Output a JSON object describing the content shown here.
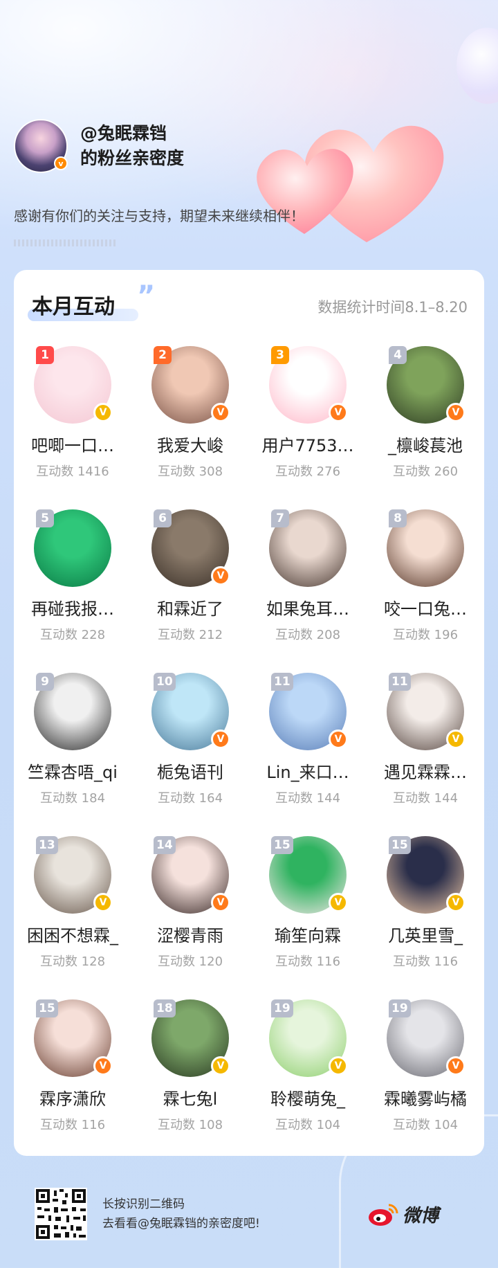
{
  "header": {
    "owner_handle": "@兔眠霖铛",
    "subtitle": "的粉丝亲密度",
    "thanks": "感谢有你们的关注与支持，期望未来继续相伴！"
  },
  "card": {
    "title": "本月互动",
    "quote": "”",
    "stat_time": "数据统计时间8.1–8.20"
  },
  "colors": {
    "rank_top1": "#ff4a4a",
    "rank_top2": "#ff6a2a",
    "rank_top3": "#ff9a00",
    "rank_other": "#b7bccb",
    "badge_orange": "#ff7a1a",
    "badge_gold": "#f5b800"
  },
  "fans": [
    {
      "rank": "1",
      "name": "吧唧一口…",
      "count": "互动数 1416",
      "badge": "gold",
      "avatar": [
        "#fde6ec",
        "#f4c7d3"
      ]
    },
    {
      "rank": "2",
      "name": "我爱大峻",
      "count": "互动数 308",
      "badge": "orange",
      "avatar": [
        "#f0c8b4",
        "#7a5347"
      ]
    },
    {
      "rank": "3",
      "name": "用户7753…",
      "count": "互动数 276",
      "badge": "orange",
      "avatar": [
        "#ffffff",
        "#ffb7c8"
      ]
    },
    {
      "rank": "4",
      "name": "_檩峻萇池",
      "count": "互动数 260",
      "badge": "orange",
      "avatar": [
        "#7fa35b",
        "#2f3d24"
      ]
    },
    {
      "rank": "5",
      "name": "再碰我报…",
      "count": "互动数 228",
      "badge": "",
      "avatar": [
        "#2fc77a",
        "#0a7a45"
      ]
    },
    {
      "rank": "6",
      "name": "和霖近了",
      "count": "互动数 212",
      "badge": "orange",
      "avatar": [
        "#8a7a6a",
        "#3a3028"
      ]
    },
    {
      "rank": "7",
      "name": "如果兔耳…",
      "count": "互动数 208",
      "badge": "",
      "avatar": [
        "#e9d8cf",
        "#4a3a33"
      ]
    },
    {
      "rank": "8",
      "name": "咬一口兔…",
      "count": "互动数 196",
      "badge": "",
      "avatar": [
        "#f5ded2",
        "#5a3a2c"
      ]
    },
    {
      "rank": "9",
      "name": "竺霖杏唔_qi",
      "count": "互动数 184",
      "badge": "",
      "avatar": [
        "#f0f0f0",
        "#2a2a2a"
      ]
    },
    {
      "rank": "10",
      "name": "栀兔语刊",
      "count": "互动数 164",
      "badge": "orange",
      "avatar": [
        "#bfe6f7",
        "#4a7a9a"
      ]
    },
    {
      "rank": "11",
      "name": "Lin_来口…",
      "count": "互动数 144",
      "badge": "orange",
      "avatar": [
        "#bcd8f7",
        "#5b7fb8"
      ]
    },
    {
      "rank": "11",
      "name": "遇见霖霖…",
      "count": "互动数 144",
      "badge": "gold",
      "avatar": [
        "#f3ece8",
        "#5a4a44"
      ]
    },
    {
      "rank": "13",
      "name": "困困不想霖_",
      "count": "互动数 128",
      "badge": "gold",
      "avatar": [
        "#e8e3dc",
        "#6a5a4e"
      ]
    },
    {
      "rank": "14",
      "name": "涩樱青雨",
      "count": "互动数 120",
      "badge": "orange",
      "avatar": [
        "#f5e1dc",
        "#3a2a28"
      ]
    },
    {
      "rank": "15",
      "name": "瑜笙向霖",
      "count": "互动数 116",
      "badge": "gold",
      "avatar": [
        "#2fb360",
        "#f2e6e6"
      ]
    },
    {
      "rank": "15",
      "name": "几英里雪_",
      "count": "互动数 116",
      "badge": "gold",
      "avatar": [
        "#2a2e4a",
        "#f0c9a5"
      ]
    },
    {
      "rank": "15",
      "name": "霖序潇欣",
      "count": "互动数 116",
      "badge": "orange",
      "avatar": [
        "#f6dfd8",
        "#6a4032"
      ]
    },
    {
      "rank": "18",
      "name": "霖七兔l",
      "count": "互动数 108",
      "badge": "gold",
      "avatar": [
        "#7ea86a",
        "#2a3a22"
      ]
    },
    {
      "rank": "19",
      "name": "聆樱萌兔_",
      "count": "互动数 104",
      "badge": "gold",
      "avatar": [
        "#e6f5dc",
        "#8fcf6f"
      ]
    },
    {
      "rank": "19",
      "name": "霖曦雾屿橘",
      "count": "互动数 104",
      "badge": "orange",
      "avatar": [
        "#e4e4e8",
        "#6a6a72"
      ]
    }
  ],
  "footer": {
    "line1": "长按识别二维码",
    "line2": "去看看@兔眠霖铛的亲密度吧!",
    "brand": "微博"
  }
}
